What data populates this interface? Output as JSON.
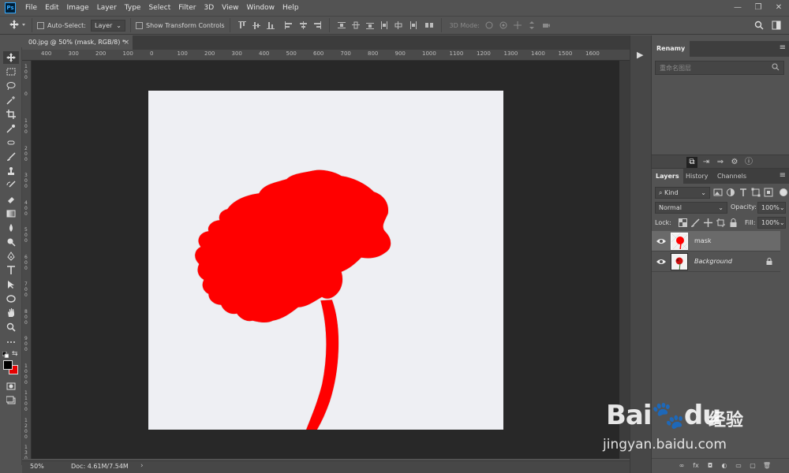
{
  "menubar": {
    "logo": "Ps",
    "items": [
      "File",
      "Edit",
      "Image",
      "Layer",
      "Type",
      "Select",
      "Filter",
      "3D",
      "View",
      "Window",
      "Help"
    ],
    "window_controls": [
      "—",
      "❐",
      "✕"
    ]
  },
  "options_bar": {
    "auto_select_label": "Auto-Select:",
    "auto_select_value": "Layer",
    "show_transform_label": "Show Transform Controls",
    "mode_label": "3D Mode:"
  },
  "document_tab": {
    "title": "00.jpg @ 50% (mask, RGB/8) *",
    "close": "×"
  },
  "ruler_top": [
    "400",
    "300",
    "200",
    "100",
    "0",
    "100",
    "200",
    "300",
    "400",
    "500",
    "600",
    "700",
    "800",
    "900",
    "1000",
    "1100",
    "1200",
    "1300",
    "1400",
    "1500",
    "1600"
  ],
  "ruler_left": [
    "1\n0\n0",
    "0",
    "1\n0\n0",
    "2\n0\n0",
    "3\n0\n0",
    "4\n0\n0",
    "5\n0\n0",
    "6\n0\n0",
    "7\n0\n0",
    "8\n0\n0",
    "9\n0\n0",
    "1\n0\n0\n0",
    "1\n1\n0\n0",
    "1\n2\n0\n0",
    "1\n3\n0\n0"
  ],
  "status_bar": {
    "zoom": "50%",
    "doc_info": "Doc: 4.61M/7.54M",
    "arrow": "›"
  },
  "panel_strip": {
    "play": "▶"
  },
  "renamy_panel": {
    "title": "Renamy",
    "search_placeholder": "重命名图层"
  },
  "layers_panel": {
    "tabs": [
      "Layers",
      "History",
      "Channels"
    ],
    "kind_label": "Kind",
    "blend_mode": "Normal",
    "opacity_label": "Opacity:",
    "opacity_value": "100%",
    "lock_label": "Lock:",
    "fill_label": "Fill:",
    "fill_value": "100%",
    "layers": [
      {
        "name": "mask",
        "visible": true,
        "selected": true
      },
      {
        "name": "Background",
        "visible": true,
        "selected": false,
        "locked": true
      }
    ],
    "footer": [
      "∞",
      "fx",
      "◘",
      "◐",
      "▭",
      "▢",
      "🗑"
    ]
  },
  "colors": {
    "foreground": "#000000",
    "background": "#e60000",
    "mask_red": "#ff0000",
    "canvas_bg": "#eeeff3"
  },
  "watermark": {
    "brand": "Bai🐾du",
    "brand_cn": "经验",
    "url": "jingyan.baidu.com"
  }
}
